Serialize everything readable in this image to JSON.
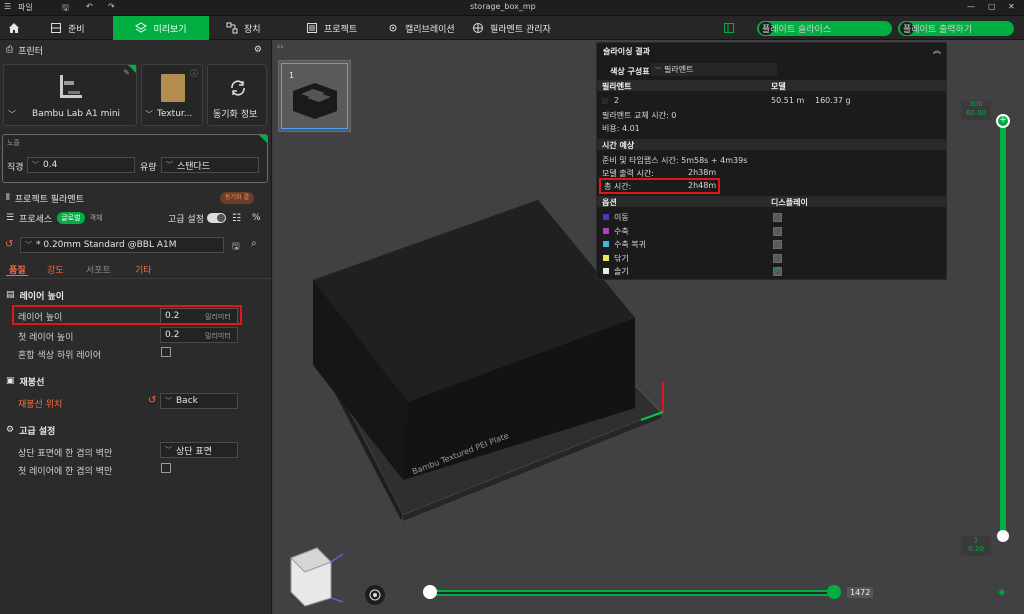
{
  "titlebar": {
    "menu": "파일",
    "title": "storage_box_mp"
  },
  "nav": {
    "tabs": [
      {
        "label": "준비"
      },
      {
        "label": "미리보기"
      },
      {
        "label": "장치"
      },
      {
        "label": "프로젝트"
      },
      {
        "label": "캘리브레이션"
      },
      {
        "label": "필라멘트 관리자"
      }
    ],
    "slice_button": "플레이트 슬라이스",
    "print_button": "플레이트 출력하기"
  },
  "left": {
    "printer_section": "프린터",
    "printer_name": "Bambu Lab A1 mini",
    "plate_name": "Textur...",
    "sync_label": "동기화 정보",
    "nozzle_label": "노즐",
    "diameter_label": "직경",
    "diameter_value": "0.4",
    "flow_label": "유량",
    "flow_value": "스탠다드",
    "project_filament": "프로젝트 필라멘트",
    "sync_badge": "동기화 결",
    "process_label": "프로세스",
    "global_label": "글로벌",
    "object_label": "객체",
    "advanced_label": "고급 설정",
    "preset": "* 0.20mm Standard @BBL A1M",
    "tabs": [
      "품질",
      "강도",
      "서포트",
      "기타"
    ],
    "layer_height_header": "레이어 높이",
    "layer_height_label": "레이어 높이",
    "layer_height_value": "0.2",
    "first_layer_label": "첫 레이어 높이",
    "first_layer_value": "0.2",
    "unit": "밀리미터",
    "mixed_color_label": "혼합 색상 하위 레이어",
    "seam_header": "재봉선",
    "seam_position_label": "재봉선 위치",
    "seam_position_value": "Back",
    "advanced_header": "고급 설정",
    "top_wall_label": "상단 표면에 한 겹의 벽만",
    "top_wall_value": "상단 표면",
    "first_wall_label": "첫 레이어에 한 겹의 벽만"
  },
  "viewport": {
    "plate_thumb_number": "1",
    "bed_label": "Bambu Textured PEI Plate",
    "slider_top_a": "300",
    "slider_top_b": "60.00",
    "slider_bottom_a": "1",
    "slider_bottom_b": "0.20",
    "h_slider_value": "1472"
  },
  "slice_result": {
    "title": "슬라이싱 결과",
    "scheme_label": "색상 구성표",
    "scheme_value": "필라멘트",
    "col_filament": "필라멘트",
    "col_model": "모델",
    "filament_index": "2",
    "model_length": "50.51 m",
    "model_weight": "160.37 g",
    "change_time_label": "필라멘트 교체 시간: 0",
    "cost_label": "비용: 4.01",
    "time_section": "시간 예상",
    "prep_label": "준비 및 타임랩스 시간: 5m58s + 4m39s",
    "model_time_label": "모델 출력 시간:",
    "model_time_value": "2h38m",
    "total_label": "총 시간:",
    "total_value": "2h48m",
    "options_col": "옵션",
    "display_col": "디스플레이",
    "options": [
      {
        "label": "이동",
        "color": "#3e3ebd"
      },
      {
        "label": "수축",
        "color": "#b33cc9"
      },
      {
        "label": "수축 복귀",
        "color": "#3fb6d6"
      },
      {
        "label": "닦기",
        "color": "#e8e85a"
      },
      {
        "label": "솔기",
        "color": "#e8e8e8"
      }
    ]
  },
  "colors": {
    "accent": "#00ae42",
    "highlight": "#e3141b",
    "orange": "#ff6a3d"
  }
}
